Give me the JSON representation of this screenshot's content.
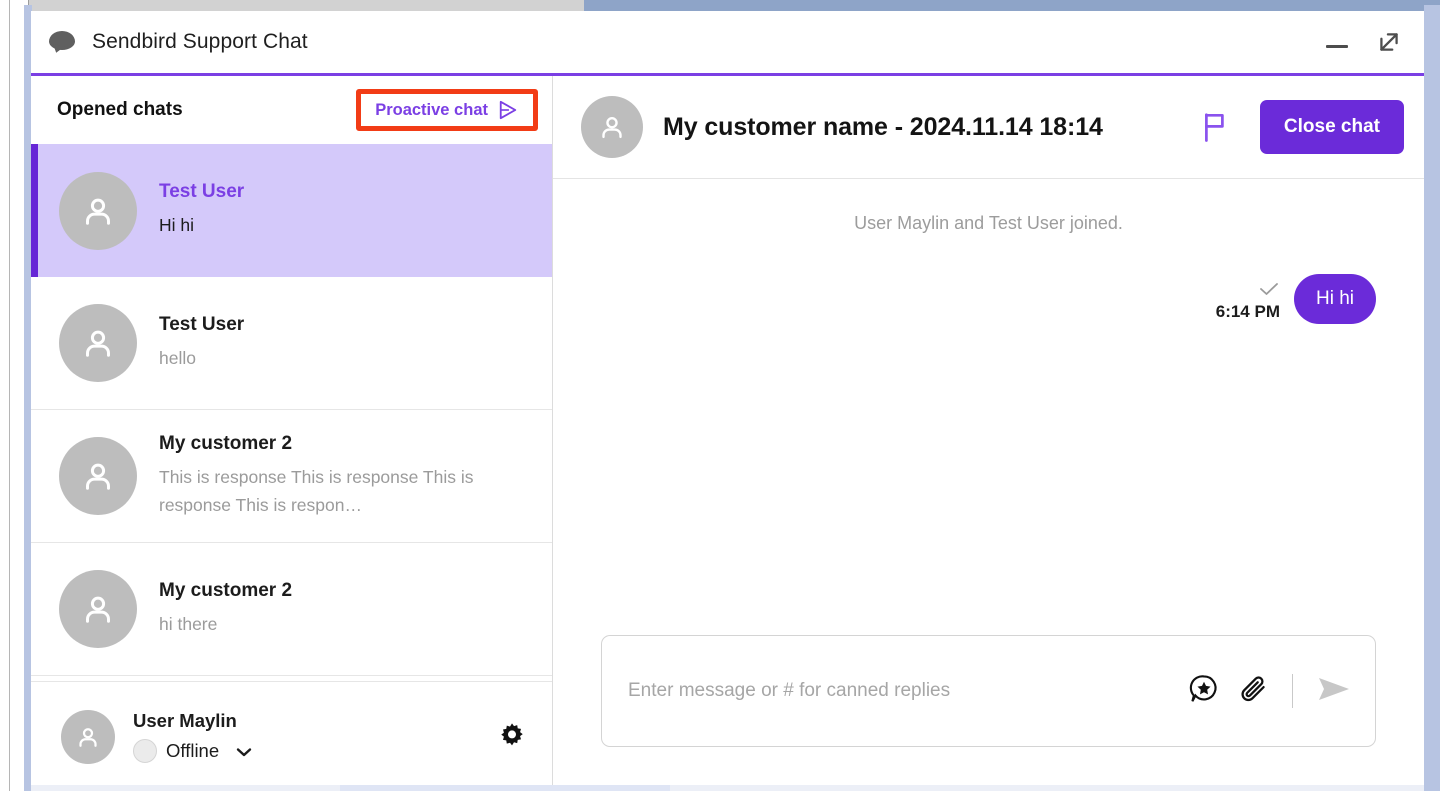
{
  "window": {
    "title": "Sendbird Support Chat",
    "bubble_icon": "chat-bubble-icon",
    "minimize_label": "Minimize",
    "expand_label": "Open in new window"
  },
  "sidebar": {
    "heading": "Opened chats",
    "proactive_button": {
      "label": "Proactive chat",
      "icon": "send-triangle-icon",
      "highlight_color": "#f23c16",
      "text_color": "#7b3fe4"
    },
    "chats": [
      {
        "name": "Test User",
        "preview": "Hi hi",
        "selected": true,
        "avatar_icon": "person-avatar-icon"
      },
      {
        "name": "Test User",
        "preview": "hello",
        "selected": false,
        "avatar_icon": "person-avatar-icon"
      },
      {
        "name": "My customer 2",
        "preview": "This is response This is response This is response This is respon…",
        "selected": false,
        "avatar_icon": "person-avatar-icon"
      },
      {
        "name": "My customer 2",
        "preview": "hi there",
        "selected": false,
        "avatar_icon": "person-avatar-icon"
      }
    ],
    "account": {
      "name": "User Maylin",
      "status": "Offline",
      "status_dot_color": "#ebebeb",
      "chevron_icon": "chevron-down-icon",
      "settings_icon": "gear-icon",
      "avatar_icon": "person-avatar-icon"
    }
  },
  "conversation": {
    "title": "My customer name - 2024.11.14 18:14",
    "avatar_icon": "person-avatar-icon",
    "flag_icon": "flag-icon",
    "close_button": "Close chat",
    "system_message": "User Maylin and Test User joined.",
    "messages": [
      {
        "text": "Hi hi",
        "time": "6:14 PM",
        "direction": "outgoing",
        "status_icon": "check-icon"
      }
    ],
    "composer": {
      "placeholder": "Enter message or # for canned replies",
      "value": "",
      "icons": [
        "canned-reply-icon",
        "attachment-icon",
        "send-icon"
      ]
    }
  },
  "colors": {
    "accent_purple": "#6b2bd9",
    "accent_purple_light": "#7b3fe4",
    "selected_row_bg": "#d4c9fa",
    "selected_row_bar": "#6626d6",
    "highlight_red": "#f23c16",
    "frame_blue": "#b7c4e2"
  }
}
